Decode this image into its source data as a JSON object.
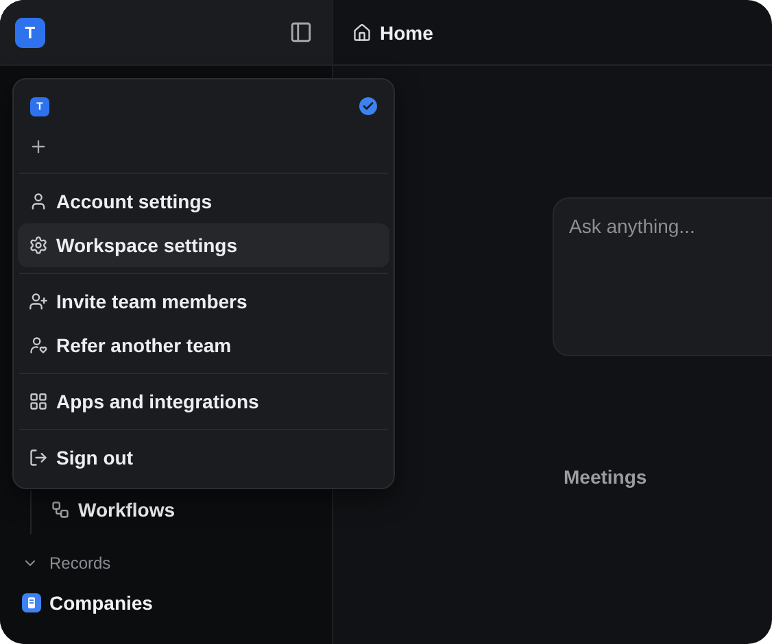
{
  "sidebar": {
    "workspace_avatar": "T",
    "items": [
      {
        "label": "Workflows"
      }
    ],
    "sections": [
      {
        "title": "Records",
        "expanded": true,
        "items": [
          {
            "label": "Companies"
          }
        ]
      }
    ]
  },
  "workspace_menu": {
    "workspaces": [
      {
        "avatar": "T",
        "selected": true
      }
    ],
    "groups": [
      [
        {
          "label": "Account settings",
          "highlighted": false
        },
        {
          "label": "Workspace settings",
          "highlighted": true
        }
      ],
      [
        {
          "label": "Invite team members",
          "highlighted": false
        },
        {
          "label": "Refer another team",
          "highlighted": false
        }
      ],
      [
        {
          "label": "Apps and integrations",
          "highlighted": false
        }
      ],
      [
        {
          "label": "Sign out",
          "highlighted": false
        }
      ]
    ]
  },
  "header": {
    "title": "Home"
  },
  "ask": {
    "placeholder": "Ask anything..."
  },
  "meetings": {
    "title": "Meetings"
  }
}
